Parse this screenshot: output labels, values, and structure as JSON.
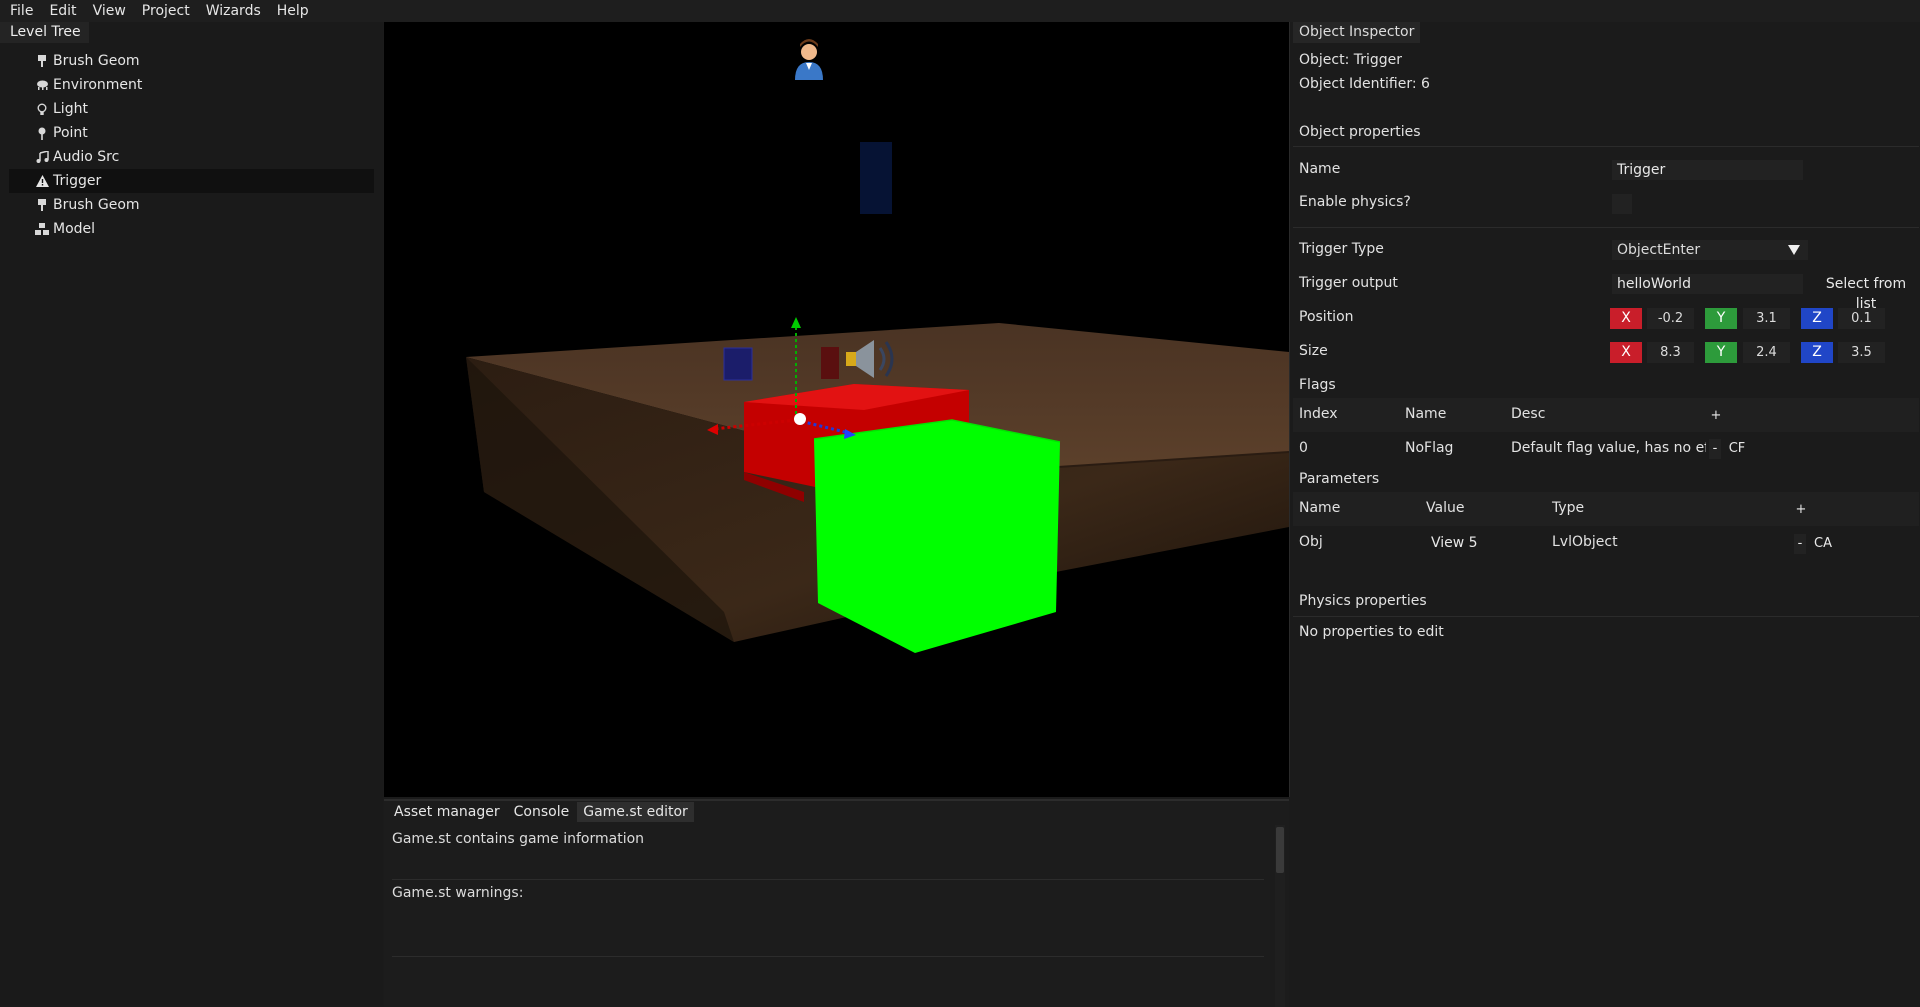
{
  "menu": [
    "File",
    "Edit",
    "View",
    "Project",
    "Wizards",
    "Help"
  ],
  "level_tree": {
    "title": "Level Tree",
    "items": [
      {
        "label": "Brush Geom",
        "icon": "brush-geom-icon"
      },
      {
        "label": "Environment",
        "icon": "cloud-icon"
      },
      {
        "label": "Light",
        "icon": "lightbulb-icon"
      },
      {
        "label": "Point",
        "icon": "map-pin-icon"
      },
      {
        "label": "Audio Src",
        "icon": "music-note-icon"
      },
      {
        "label": "Trigger",
        "icon": "warning-triangle-icon",
        "selected": true
      },
      {
        "label": "Brush Geom",
        "icon": "brush-geom-icon"
      },
      {
        "label": "Model",
        "icon": "cubes-icon"
      }
    ]
  },
  "bottom_panel": {
    "tabs": [
      "Asset manager",
      "Console",
      "Game.st editor"
    ],
    "active_tab": "Game.st editor",
    "info_text": "Game.st contains game information",
    "warnings_label": "Game.st warnings:"
  },
  "inspector": {
    "title": "Object Inspector",
    "object_line": "Object: Trigger",
    "identifier_line": "Object Identifier: 6",
    "object_properties_label": "Object properties",
    "name_label": "Name",
    "name_value": "Trigger",
    "physics_label": "Enable physics?",
    "trigger_type_label": "Trigger Type",
    "trigger_type_value": "ObjectEnter",
    "trigger_output_label": "Trigger output",
    "trigger_output_value": "helloWorld",
    "select_from_list": "Select from list",
    "position_label": "Position",
    "size_label": "Size",
    "axis_x": "X",
    "axis_y": "Y",
    "axis_z": "Z",
    "position": {
      "x": "-0.2",
      "y": "3.1",
      "z": "0.1"
    },
    "size": {
      "x": "8.3",
      "y": "2.4",
      "z": "3.5"
    },
    "flags_label": "Flags",
    "flags_headers": {
      "index": "Index",
      "name": "Name",
      "desc": "Desc",
      "add": "+"
    },
    "flags_rows": [
      {
        "index": "0",
        "name": "NoFlag",
        "desc": "Default flag value, has no effect",
        "remove": "-",
        "action": "CF"
      }
    ],
    "parameters_label": "Parameters",
    "params_headers": {
      "name": "Name",
      "value": "Value",
      "type": "Type",
      "add": "+"
    },
    "params_rows": [
      {
        "name": "Obj",
        "value": "View 5",
        "type": "LvlObject",
        "remove": "-",
        "action": "CA"
      }
    ],
    "physics_properties_label": "Physics properties",
    "no_properties": "No properties to edit"
  },
  "colors": {
    "axis_x": "#c91e2a",
    "axis_y": "#2d9b3b",
    "axis_z": "#2046c7",
    "trigger_green": "#00ff00",
    "trigger_red": "#c00000"
  }
}
